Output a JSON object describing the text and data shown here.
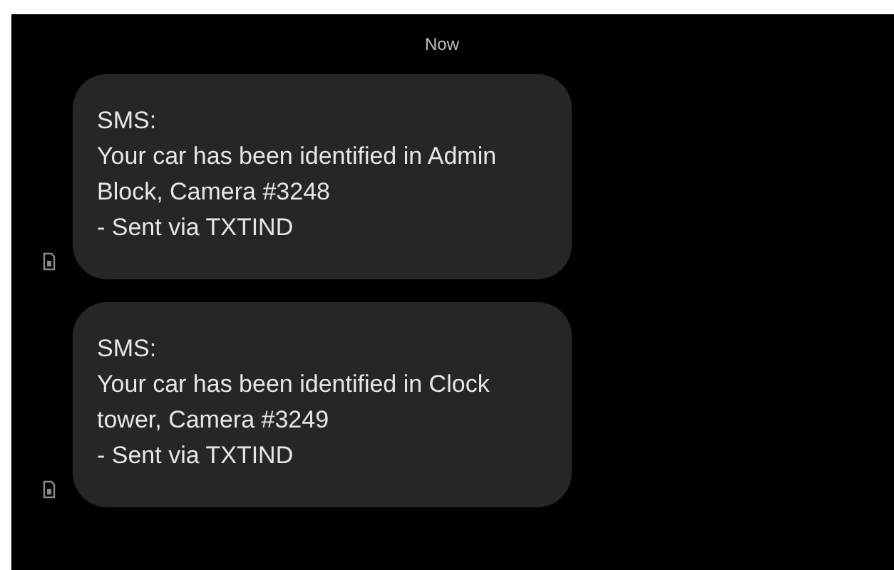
{
  "timestamp": "Now",
  "messages": [
    {
      "header": "SMS:",
      "body": "Your car has been identified in Admin Block, Camera #3248",
      "footer": "- Sent via TXTIND"
    },
    {
      "header": "SMS:",
      "body": "Your car has been identified in Clock tower, Camera #3249",
      "footer": "- Sent via TXTIND"
    }
  ]
}
